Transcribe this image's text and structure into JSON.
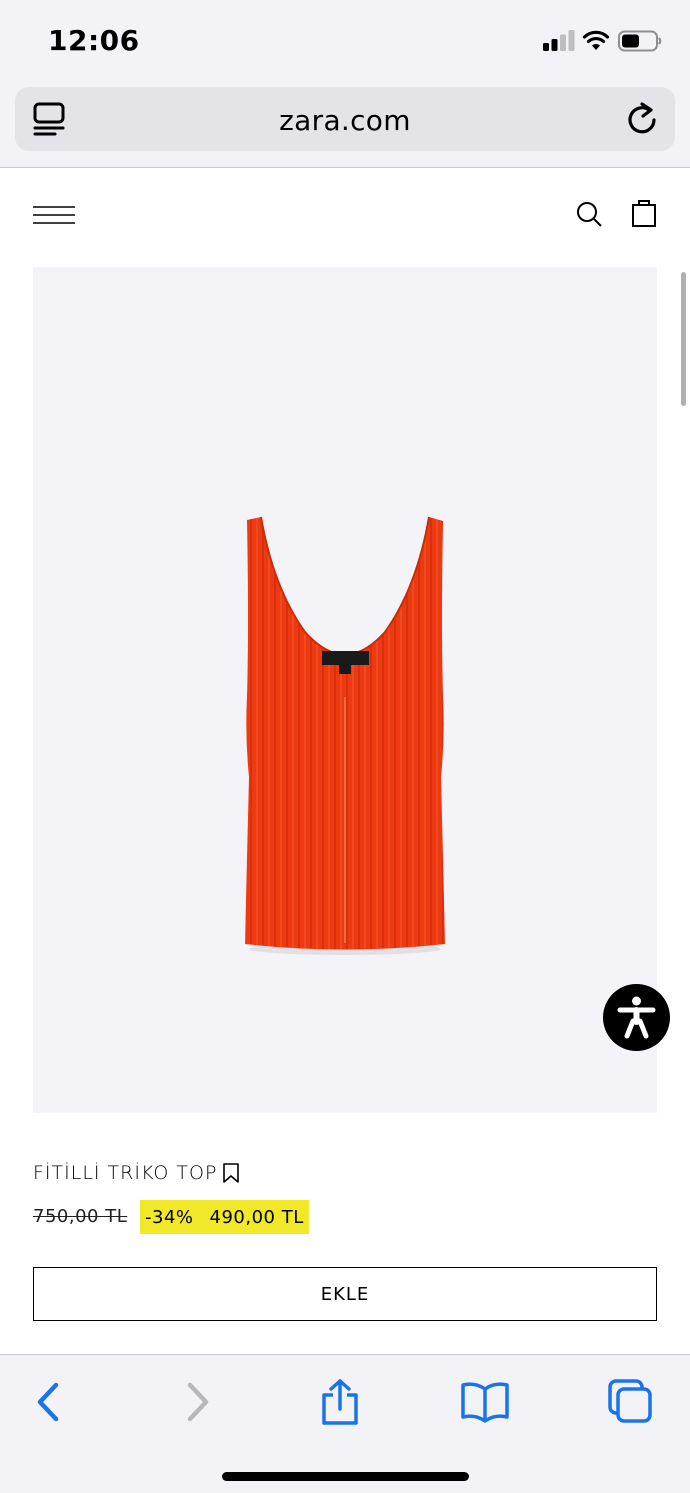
{
  "status_bar": {
    "time": "12:06"
  },
  "browser": {
    "url": "zara.com"
  },
  "product": {
    "name": "FİTİLLİ TRİKO TOP",
    "old_price": "750,00 TL",
    "discount": "-34%",
    "price": "490,00 TL",
    "add_label": "EKLE",
    "garment_color": "#ee3a12"
  },
  "colors": {
    "sale_highlight": "#f1e82a",
    "ios_blue": "#1a73e8",
    "image_background": "#f4f3f8"
  },
  "icons": [
    "signal-icon",
    "wifi-icon",
    "battery-icon",
    "reader-icon",
    "reload-icon",
    "menu-icon",
    "search-icon",
    "bag-icon",
    "bookmark-icon",
    "accessibility-icon",
    "back-icon",
    "forward-icon",
    "share-icon",
    "bookmarks-icon",
    "tabs-icon"
  ]
}
